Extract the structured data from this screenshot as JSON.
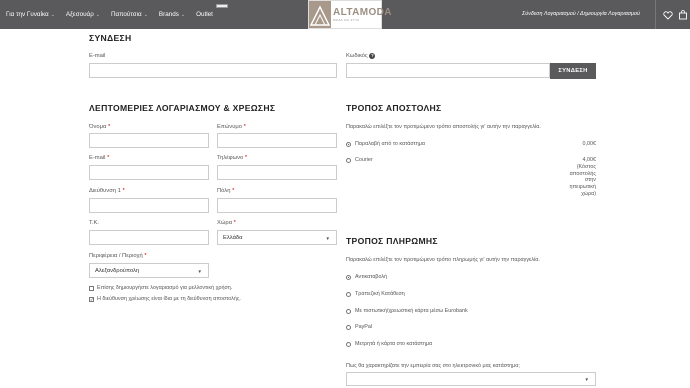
{
  "header": {
    "nav": [
      {
        "label": "Για την Γυναίκα",
        "dropdown": true
      },
      {
        "label": "Αξεσουάρ",
        "dropdown": true
      },
      {
        "label": "Παπούτσια",
        "dropdown": true
      },
      {
        "label": "Brands",
        "dropdown": true
      },
      {
        "label": "Outlet",
        "dropdown": false
      }
    ],
    "logo_text": "ALTAMODA",
    "logo_subtext": "ΜΟΔΑ ΚΑΙ ΣΤΥΛ",
    "account_link": "Σύνδεση Λογαριασμού / Δημιουργία Λογαριασμού",
    "icons": [
      "heart-icon",
      "bag-icon"
    ]
  },
  "login": {
    "title": "ΣΥΝΔΕΣΗ",
    "email_label": "E-mail",
    "password_label": "Κωδικός",
    "help_icon": "?",
    "button": "ΣΥΝΔΕΣΗ"
  },
  "billing": {
    "title": "ΛΕΠΤΟΜΕΡΙΕΣ ΛΟΓΑΡΙΑΣΜΟΥ & ΧΡΕΩΣΗΣ",
    "first_name": "Όνομα",
    "last_name": "Επώνυμο",
    "email": "E-mail",
    "phone": "Τηλέφωνο",
    "address": "Διεύθυνση 1",
    "city": "Πόλη",
    "postcode": "Τ.Κ.",
    "country": "Χώρα",
    "country_value": "Ελλάδα",
    "region": "Περιφέρεια / Περιοχή",
    "region_value": "Αλεξανδρούπολη",
    "required_mark": "*",
    "create_account": "Επίσης δημιουργήστε λογαριασμό για μελλοντική χρήση.",
    "same_address": "Η διεύθυνση χρέωσης είναι ίδια με τη διεύθυνση αποστολής.",
    "same_address_checked": true
  },
  "shipping": {
    "title": "ΤΡΟΠΟΣ ΑΠΟΣΤΟΛΗΣ",
    "intro": "Παρακαλώ επιλέξτε τον προτιμώμενο τρόπο αποστολής γι' αυτήν την παραγγελία.",
    "options": [
      {
        "label": "Παραλαβή από το κατάστημα",
        "price": "0,00€",
        "selected": true
      },
      {
        "label": "Courier",
        "price": "4,00€",
        "note": [
          "(Κόστος",
          "αποστολής",
          "στην",
          "ηπειρωτική",
          "χώρα)"
        ],
        "selected": false
      }
    ]
  },
  "payment": {
    "title": "ΤΡΟΠΟΣ ΠΛΗΡΩΜΗΣ",
    "intro": "Παρακαλώ επιλέξτε τον προτιμώμενο τρόπο πληρωμής γι' αυτήν την παραγγελία.",
    "options": [
      {
        "label": "Αντικαταβολή",
        "selected": true
      },
      {
        "label": "Τραπεζική Κατάθεση",
        "selected": false
      },
      {
        "label": "Με πιστωτική/χρεωστική κάρτα μέσω Eurobank",
        "selected": false
      },
      {
        "label": "PayPal",
        "selected": false
      },
      {
        "label": "Μετρητά ή κάρτα στο κατάστημα",
        "selected": false
      }
    ],
    "rating_question": "Πως θα χαρακτηρίζατε την εμπειρία σας στο ηλεκτρονικό μας κατάστημα;"
  }
}
